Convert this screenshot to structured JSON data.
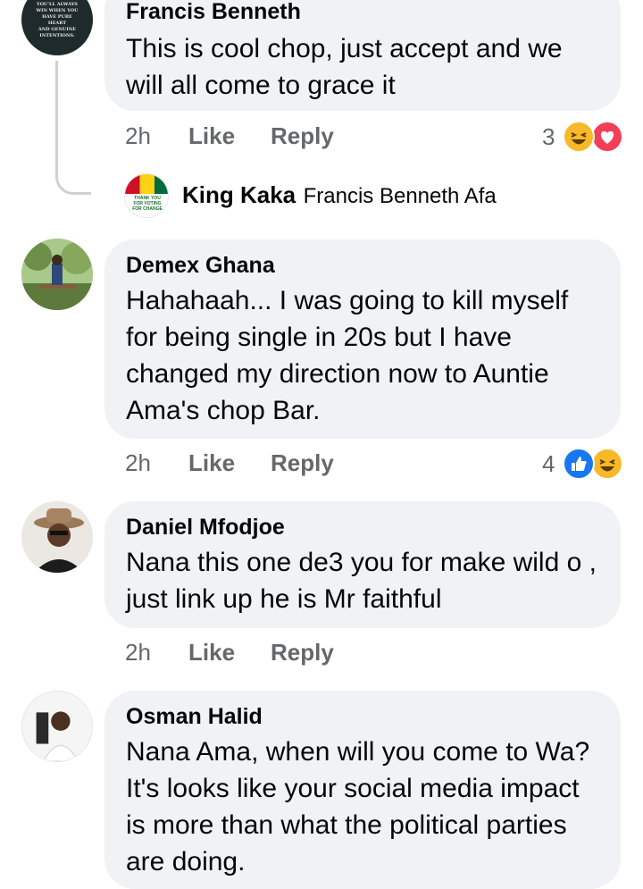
{
  "comments": [
    {
      "author": "Francis Benneth",
      "text": "This is cool chop, just accept and we will all come to grace it",
      "time": "2h",
      "like": "Like",
      "reply": "Reply",
      "reaction_count": "3",
      "reactions": [
        "haha-icon",
        "love-icon"
      ],
      "avatar_text": [
        "YOU'LL ALWAYS",
        "WIN WHEN YOU",
        "HAVE PURE HEART",
        "AND GENUINE",
        "INTENTIONS."
      ]
    },
    {
      "reply_author": "King Kaka",
      "reply_preview": "Francis Benneth Afa",
      "avatar_text": [
        "THANK YOU",
        "FOR VOTING",
        "FOR CHANGE"
      ]
    },
    {
      "author": "Demex Ghana",
      "text": "Hahahaah... I was going to kill myself for being single in 20s but I have changed my direction now to Auntie Ama's chop Bar.",
      "time": "2h",
      "like": "Like",
      "reply": "Reply",
      "reaction_count": "4",
      "reactions": [
        "like-icon",
        "haha-icon"
      ]
    },
    {
      "author": "Daniel Mfodjoe",
      "text": "Nana this one de3 you for make wild o , just link up he is Mr faithful",
      "time": "2h",
      "like": "Like",
      "reply": "Reply"
    },
    {
      "author": "Osman Halid",
      "text": "Nana Ama, when will you come to Wa? It's looks like your social media impact is more than what the political parties are doing."
    }
  ],
  "colors": {
    "bubble": "#f0f2f5",
    "meta": "#65676b",
    "like_blue": "#1877f2",
    "love_red": "#f33e58",
    "haha_yellow": "#f7b928"
  }
}
